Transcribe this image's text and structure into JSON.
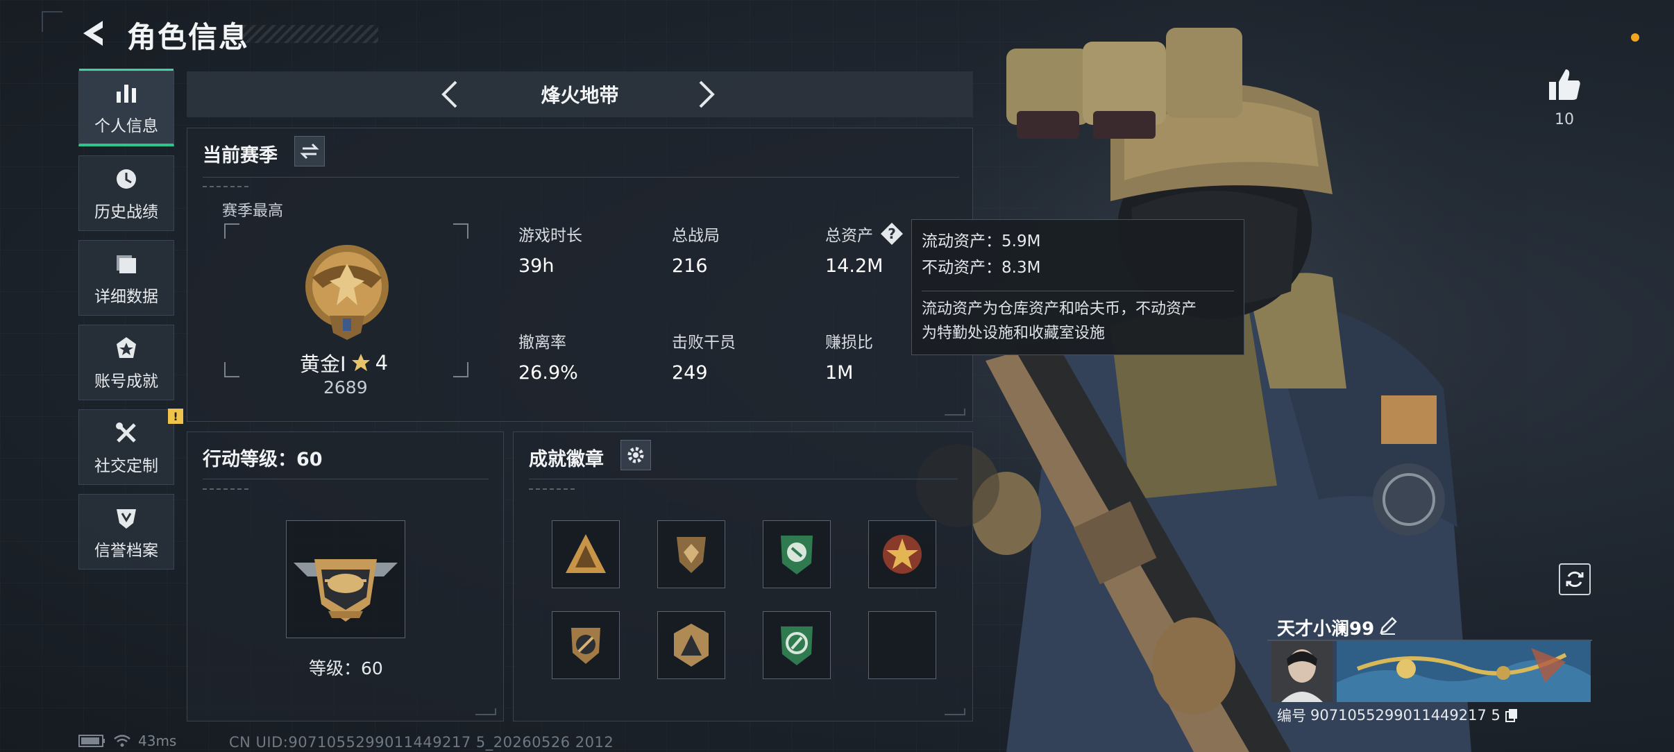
{
  "header": {
    "title": "角色信息",
    "back_icon": "back-arrow-icon"
  },
  "sidebar": {
    "items": [
      {
        "label": "个人信息",
        "icon": "bar-chart-icon",
        "active": true
      },
      {
        "label": "历史战绩",
        "icon": "history-clock-icon",
        "active": false
      },
      {
        "label": "详细数据",
        "icon": "folder-icon",
        "active": false
      },
      {
        "label": "账号成就",
        "icon": "achievement-icon",
        "active": false
      },
      {
        "label": "社交定制",
        "icon": "tools-icon",
        "active": false,
        "badge": "!"
      },
      {
        "label": "信誉档案",
        "icon": "reputation-shield-icon",
        "active": false
      }
    ]
  },
  "mode": {
    "title": "烽火地带"
  },
  "season": {
    "title": "当前赛季",
    "subtitle": "赛季最高",
    "rank_name": "黄金I",
    "rank_stars": "4",
    "rank_score": "2689",
    "stats": [
      {
        "label": "游戏时长",
        "value": "39h"
      },
      {
        "label": "总战局",
        "value": "216"
      },
      {
        "label": "总资产",
        "value": "14.2M"
      },
      {
        "label": "撤离率",
        "value": "26.9%"
      },
      {
        "label": "击败干员",
        "value": "249"
      },
      {
        "label": "赚损比",
        "value": "1M"
      }
    ]
  },
  "tooltip": {
    "line1": "流动资产：5.9M",
    "line2": "不动资产：8.3M",
    "desc1": "流动资产为仓库资产和哈夫币，不动资产",
    "desc2": "为特勤处设施和收藏室设施"
  },
  "action_level": {
    "title": "行动等级：60",
    "level_text": "等级：60"
  },
  "badges": {
    "title": "成就徽章",
    "items": [
      "triangle-squad-badge",
      "shield-eagle-badge",
      "green-emblem-badge",
      "star-cross-badge",
      "round-shield-badge",
      "triangle-shield-badge",
      "green-cycle-badge",
      "empty-slot"
    ]
  },
  "likes": {
    "count": "10"
  },
  "player": {
    "name": "天才小澜99",
    "id_label": "编号",
    "id_value": "9071055299011449217 5"
  },
  "status": {
    "ping": "43ms",
    "uid": "CN UID:9071055299011449217 5_20260526 2012"
  },
  "colors": {
    "accent": "#2ec48b",
    "badge": "#f0c34a",
    "dot": "#f2a620"
  }
}
